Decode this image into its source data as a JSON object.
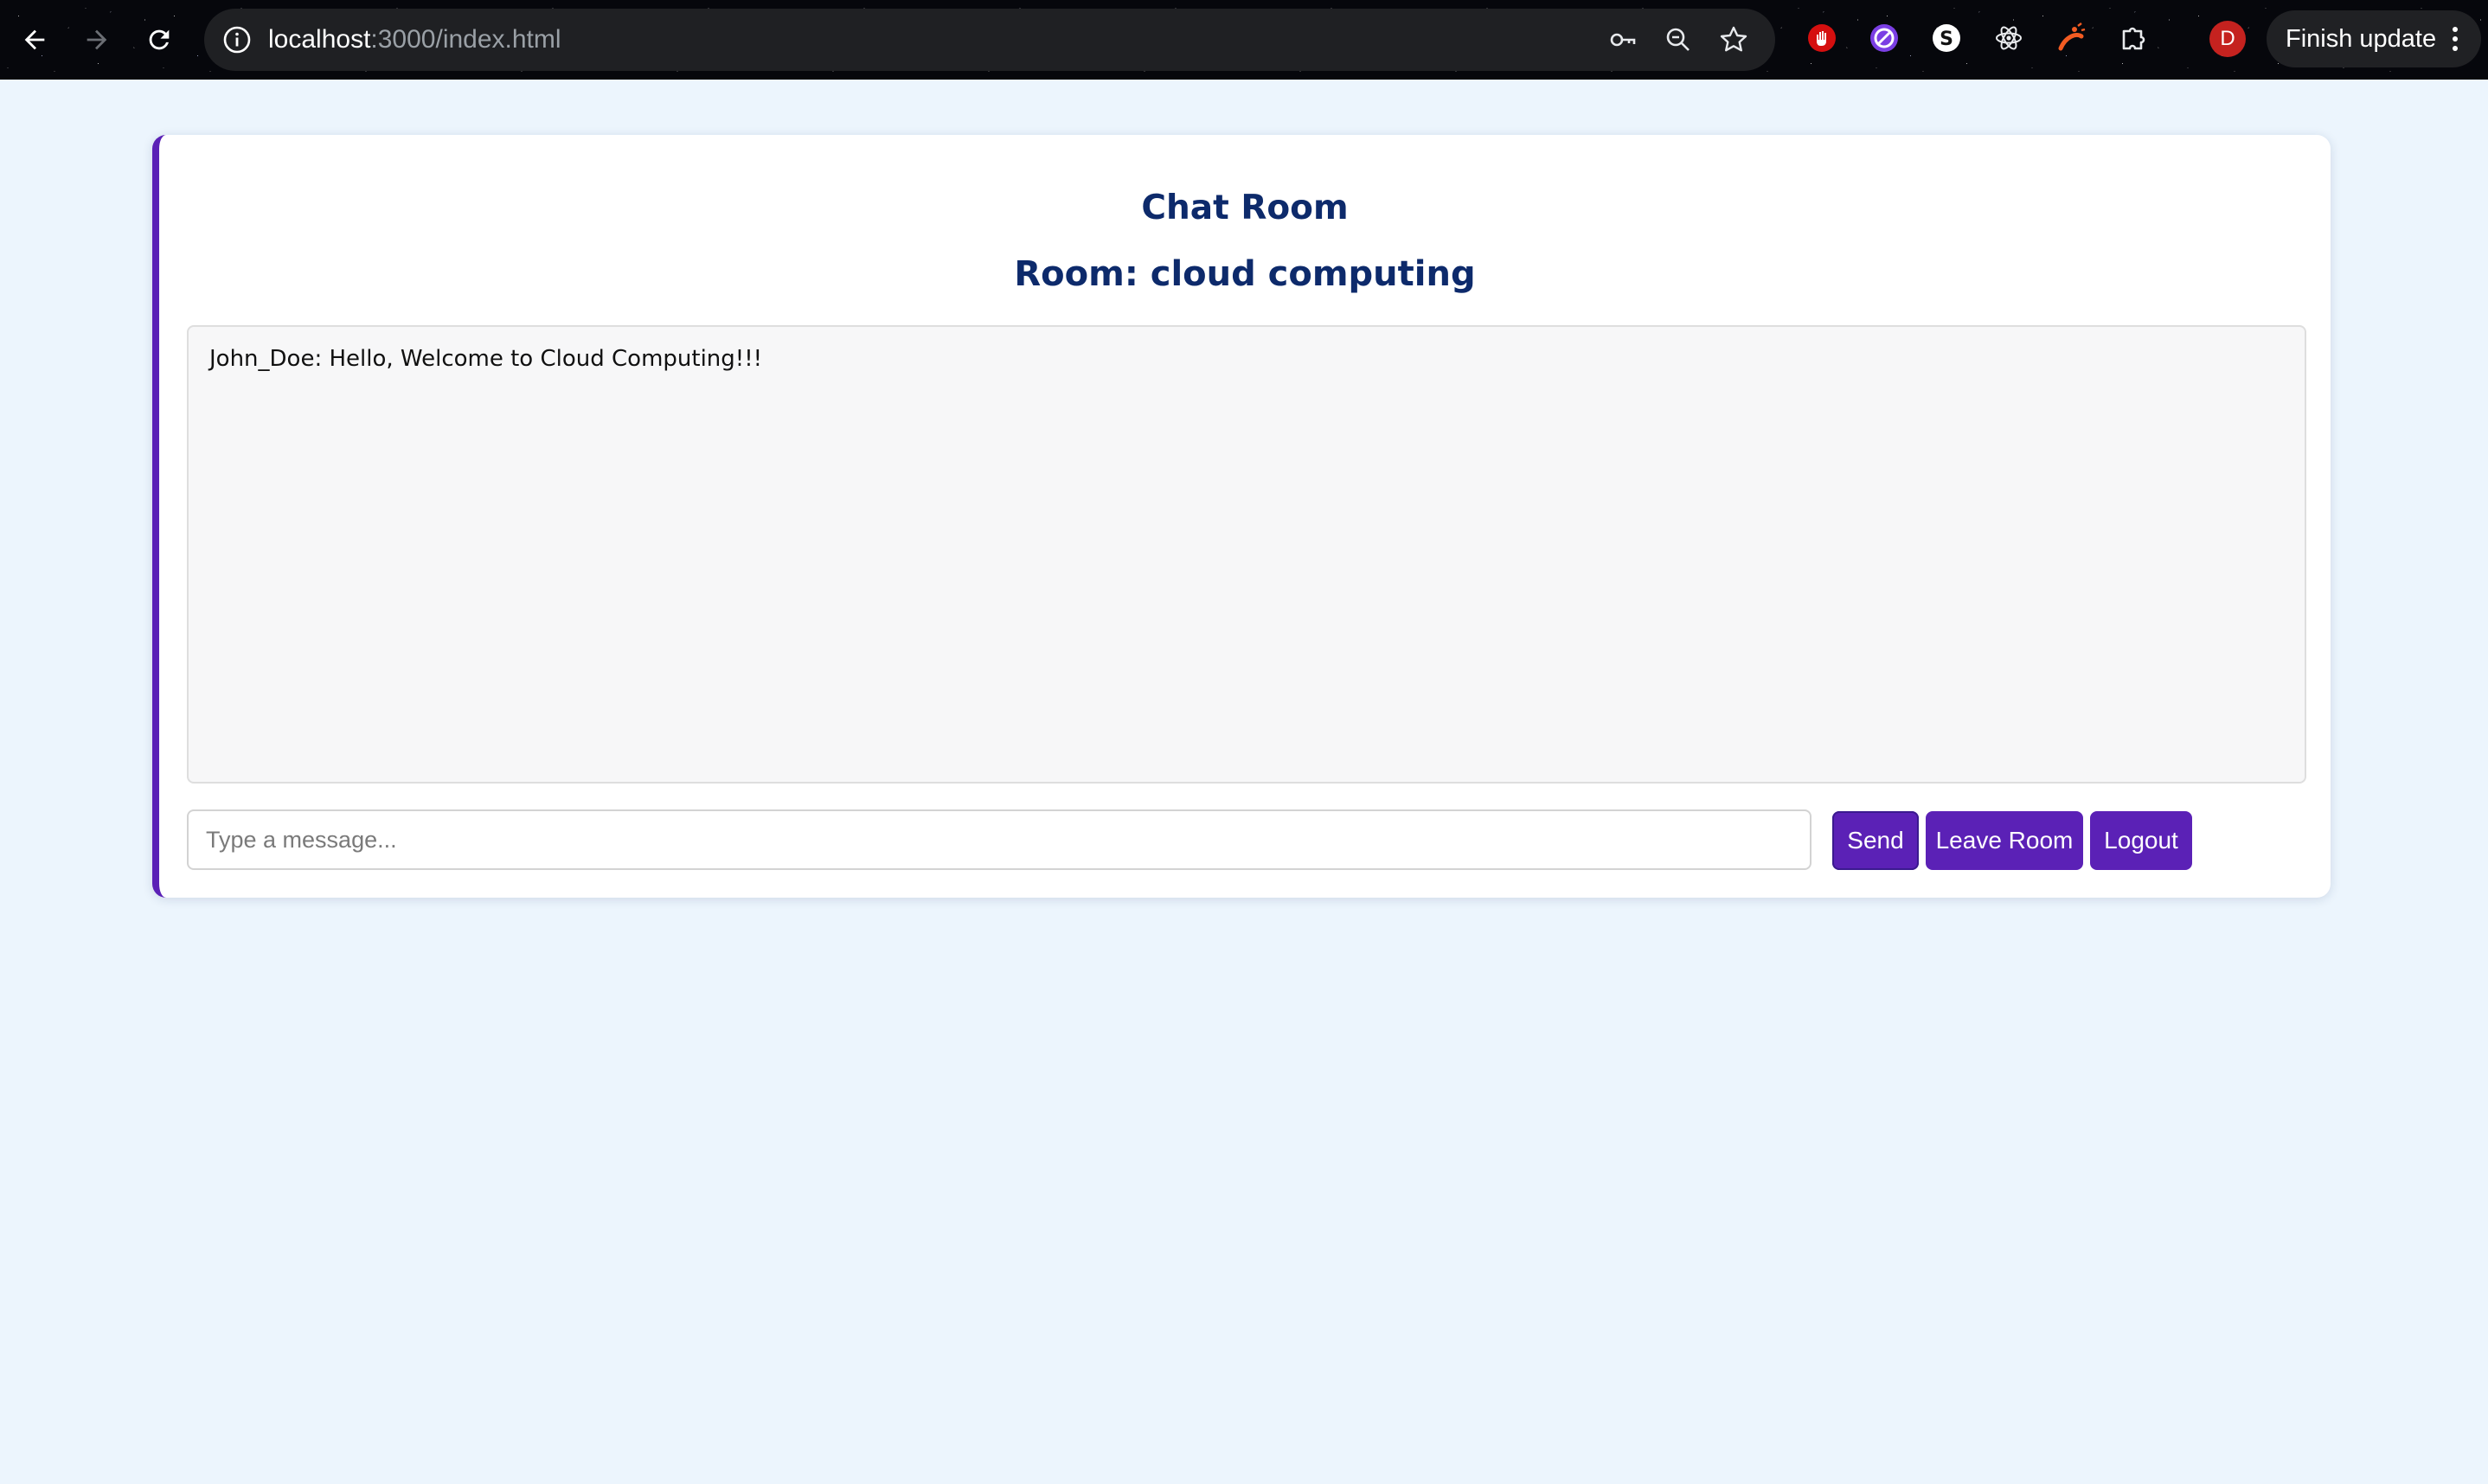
{
  "browser": {
    "url_host": "localhost",
    "url_path": ":3000/index.html",
    "finish_update_label": "Finish update",
    "avatar_letter": "D",
    "nav_icons": [
      "back-arrow-icon",
      "forward-arrow-icon",
      "reload-icon"
    ],
    "omnibox_icons": [
      "site-info-icon",
      "password-key-icon",
      "zoom-icon",
      "bookmark-star-icon"
    ],
    "extension_icons": [
      "red-hand-extension-icon",
      "blocker-extension-icon",
      "s-extension-icon",
      "react-devtools-icon",
      "redux-extension-icon",
      "extensions-puzzle-icon"
    ]
  },
  "chat": {
    "title": "Chat Room",
    "room_label": "Room: cloud computing",
    "messages": [
      {
        "text": "John_Doe: Hello, Welcome to Cloud Computing!!!"
      }
    ],
    "input": {
      "placeholder": "Type a message...",
      "value": ""
    },
    "buttons": {
      "send": "Send",
      "leave": "Leave Room",
      "logout": "Logout"
    }
  },
  "colors": {
    "page_background": "#ecf5fd",
    "accent_purple": "#5b21b6",
    "heading_navy": "#0d2a6b",
    "chrome_dark": "#06070c"
  }
}
